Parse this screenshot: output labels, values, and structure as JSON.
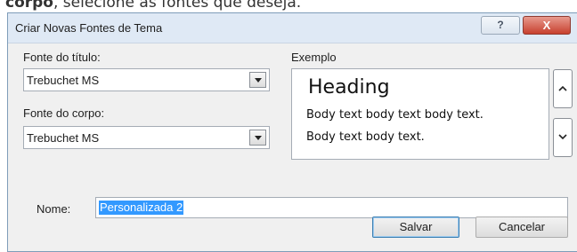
{
  "caption": {
    "bold": "corpo",
    "rest": ", selecione as fontes que deseja."
  },
  "window": {
    "title": "Criar Novas Fontes de Tema",
    "help_label": "?",
    "close_label": "X"
  },
  "heading_font": {
    "label": "Fonte do título:",
    "value": "Trebuchet MS"
  },
  "body_font": {
    "label": "Fonte do corpo:",
    "value": "Trebuchet MS"
  },
  "example": {
    "label": "Exemplo",
    "heading": "Heading",
    "body_line1": "Body text body text body text.",
    "body_line2": "Body text body text."
  },
  "name": {
    "label": "Nome:",
    "value": "Personalizada 2"
  },
  "buttons": {
    "save": "Salvar",
    "cancel": "Cancelar"
  }
}
